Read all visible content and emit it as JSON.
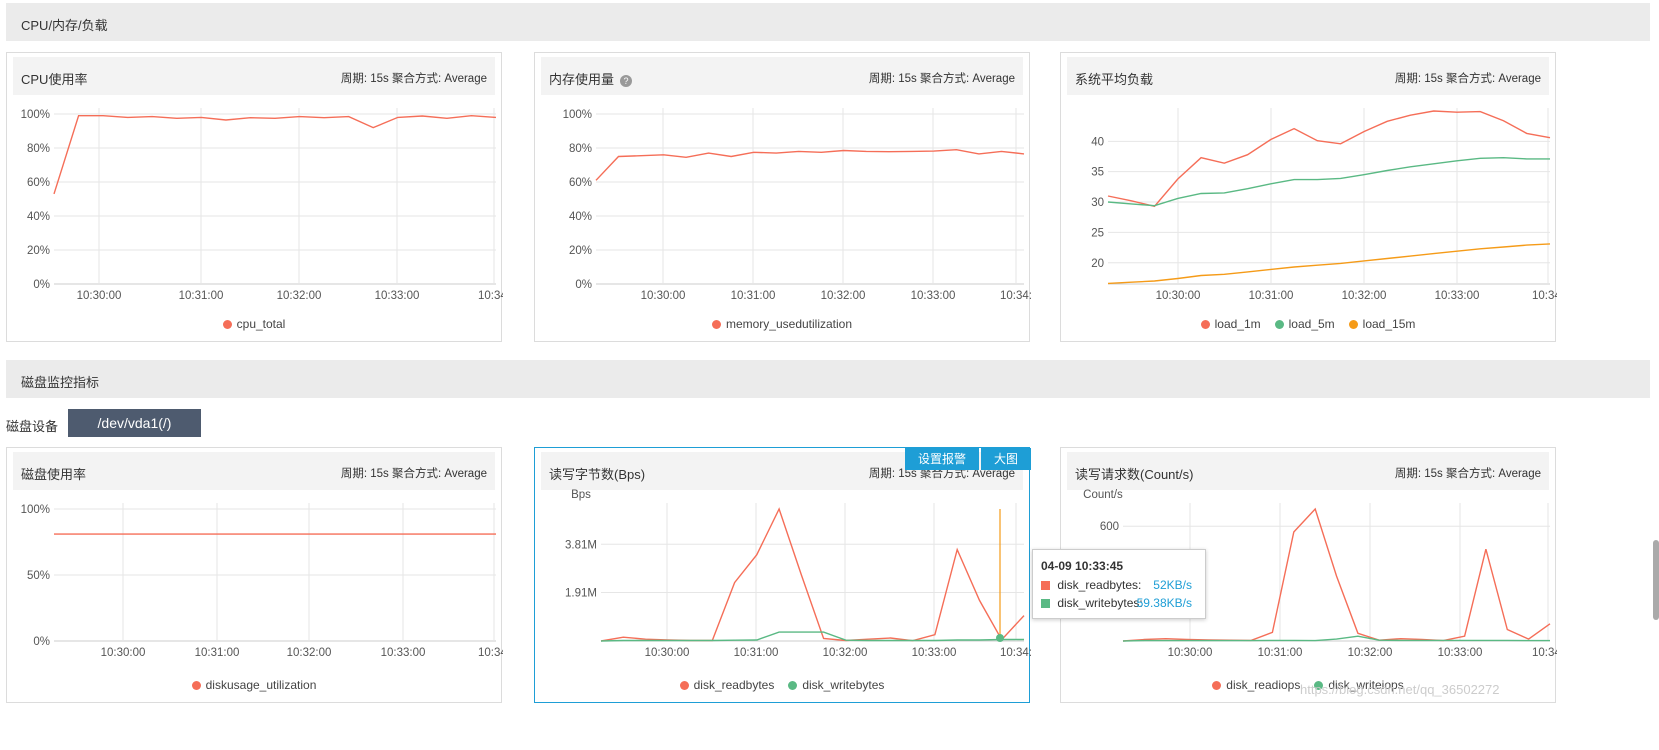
{
  "sections": {
    "cpu_title": "CPU/内存/负载",
    "disk_title": "磁盘监控指标"
  },
  "meta": {
    "period": "周期: 15s  聚合方式: Average"
  },
  "disk_selector": {
    "label": "磁盘设备",
    "value": "/dev/vda1(/)"
  },
  "actions": {
    "set_alarm": "设置报警",
    "enlarge": "大图"
  },
  "panels": {
    "cpu": {
      "title": "CPU使用率"
    },
    "mem": {
      "title": "内存使用量",
      "help": "?"
    },
    "load": {
      "title": "系统平均负载"
    },
    "disk_usage": {
      "title": "磁盘使用率"
    },
    "disk_bytes": {
      "title": "读写字节数(Bps)"
    },
    "disk_iops": {
      "title": "读写请求数(Count/s)"
    }
  },
  "tooltip": {
    "title": "04-09 10:33:45",
    "rows": [
      {
        "name": "disk_readbytes:",
        "value": "52KB/s",
        "color": "#f56e58"
      },
      {
        "name": "disk_writebytes:",
        "value": "59.38KB/s",
        "color": "#5ab984"
      }
    ]
  },
  "watermark": "https://blog.csdn.net/qq_36502272",
  "colors": {
    "red": "#f56e58",
    "green": "#5ab984",
    "orange": "#f59b18",
    "accent": "#1e9ed6"
  },
  "chart_data": [
    {
      "id": "cpu",
      "type": "line",
      "title": "CPU使用率",
      "x_ticks": [
        "10:30:00",
        "10:31:00",
        "10:32:00",
        "10:33:00",
        "10:34:"
      ],
      "y_ticks": [
        "100%",
        "80%",
        "60%",
        "40%",
        "20%",
        "0%"
      ],
      "ylim": [
        0,
        100
      ],
      "grid": true,
      "legend": "bottom",
      "series": [
        {
          "name": "cpu_total",
          "color": "#f56e58",
          "values": [
            53,
            99,
            99,
            98,
            98.5,
            97.5,
            98,
            96.5,
            97.8,
            97.5,
            98.5,
            97.8,
            98.5,
            92,
            98,
            98.8,
            97.5,
            99,
            98
          ]
        }
      ]
    },
    {
      "id": "mem",
      "type": "line",
      "title": "内存使用量",
      "x_ticks": [
        "10:30:00",
        "10:31:00",
        "10:32:00",
        "10:33:00",
        "10:34:"
      ],
      "y_ticks": [
        "100%",
        "80%",
        "60%",
        "40%",
        "20%",
        "0%"
      ],
      "ylim": [
        0,
        100
      ],
      "grid": true,
      "legend": "bottom",
      "series": [
        {
          "name": "memory_usedutilization",
          "color": "#f56e58",
          "values": [
            61,
            75,
            75.5,
            76,
            74.5,
            77,
            75,
            77.5,
            77,
            78,
            77.5,
            78.5,
            78,
            77.8,
            78,
            78.2,
            79,
            76.5,
            78,
            76.5
          ]
        }
      ]
    },
    {
      "id": "load",
      "type": "line",
      "title": "系统平均负载",
      "x_ticks": [
        "10:30:00",
        "10:31:00",
        "10:32:00",
        "10:33:00",
        "10:34:"
      ],
      "y_ticks": [
        "40",
        "35",
        "30",
        "25",
        "20"
      ],
      "ylim": [
        16.5,
        44.5
      ],
      "grid": true,
      "legend": "bottom",
      "series": [
        {
          "name": "load_1m",
          "color": "#f56e58",
          "values": [
            31,
            30.2,
            29.3,
            33.8,
            37.3,
            36.4,
            37.8,
            40.3,
            42.1,
            40.1,
            39.6,
            41.6,
            43.3,
            44.3,
            45,
            44.8,
            44.9,
            43.4,
            41.3,
            40.6
          ]
        },
        {
          "name": "load_5m",
          "color": "#5ab984",
          "values": [
            30,
            29.7,
            29.4,
            30.6,
            31.4,
            31.5,
            32.2,
            33,
            33.7,
            33.7,
            33.9,
            34.5,
            35.2,
            35.8,
            36.3,
            36.8,
            37.2,
            37.3,
            37.1,
            37.1
          ]
        },
        {
          "name": "load_15m",
          "color": "#f59b18",
          "values": [
            16.6,
            16.8,
            17,
            17.4,
            17.9,
            18.1,
            18.5,
            18.9,
            19.3,
            19.6,
            19.9,
            20.3,
            20.7,
            21.1,
            21.5,
            21.9,
            22.3,
            22.6,
            22.9,
            23.1
          ]
        }
      ]
    },
    {
      "id": "disk_usage",
      "type": "line",
      "title": "磁盘使用率",
      "x_ticks": [
        "10:30:00",
        "10:31:00",
        "10:32:00",
        "10:33:00",
        "10:34:"
      ],
      "y_ticks": [
        "100%",
        "50%",
        "0%"
      ],
      "ylim": [
        0,
        100
      ],
      "grid": true,
      "legend": "bottom",
      "series": [
        {
          "name": "diskusage_utilization",
          "color": "#f56e58",
          "values": [
            81,
            81,
            81,
            81,
            81,
            81,
            81,
            81,
            81,
            81,
            81,
            81,
            81,
            81,
            81,
            81,
            81,
            81,
            81,
            81
          ]
        }
      ]
    },
    {
      "id": "disk_bytes",
      "type": "line",
      "title": "读写字节数(Bps)",
      "y_unit": "Bps",
      "x_ticks": [
        "10:30:00",
        "10:31:00",
        "10:32:00",
        "10:33:00",
        "10:34:"
      ],
      "y_ticks": [
        "3.81M",
        "1.91M"
      ],
      "ylim": [
        0,
        5.2
      ],
      "grid": true,
      "legend": "bottom",
      "series": [
        {
          "name": "disk_readbytes",
          "color": "#f56e58",
          "values": [
            0,
            0.15,
            0.07,
            0.04,
            0.02,
            0.02,
            2.3,
            3.4,
            5.2,
            2.6,
            0.1,
            0.02,
            0.07,
            0.12,
            0.01,
            0.25,
            3.6,
            1.6,
            0.05,
            1.0
          ]
        },
        {
          "name": "disk_writebytes",
          "color": "#5ab984",
          "values": [
            0,
            0.02,
            0.02,
            0.02,
            0.02,
            0.02,
            0.03,
            0.04,
            0.35,
            0.35,
            0.35,
            0.03,
            0.02,
            0.02,
            0.02,
            0.02,
            0.04,
            0.04,
            0.06,
            0.06
          ]
        }
      ]
    },
    {
      "id": "disk_iops",
      "type": "line",
      "title": "读写请求数(Count/s)",
      "y_unit": "Count/s",
      "x_ticks": [
        "10:30:00",
        "10:31:00",
        "10:32:00",
        "10:33:00",
        "10:34:"
      ],
      "y_ticks": [
        "600"
      ],
      "ylim": [
        0,
        690
      ],
      "grid": true,
      "legend": "bottom",
      "series": [
        {
          "name": "disk_readiops",
          "color": "#f56e58",
          "values": [
            0,
            8,
            12,
            8,
            6,
            4,
            3,
            45,
            570,
            690,
            340,
            40,
            4,
            12,
            8,
            2,
            25,
            480,
            60,
            10,
            90
          ]
        },
        {
          "name": "disk_writeiops",
          "color": "#5ab984",
          "values": [
            0,
            2,
            2,
            2,
            2,
            2,
            2,
            3,
            3,
            2,
            10,
            25,
            4,
            3,
            3,
            3,
            3,
            3,
            3,
            2,
            2
          ]
        }
      ]
    }
  ]
}
